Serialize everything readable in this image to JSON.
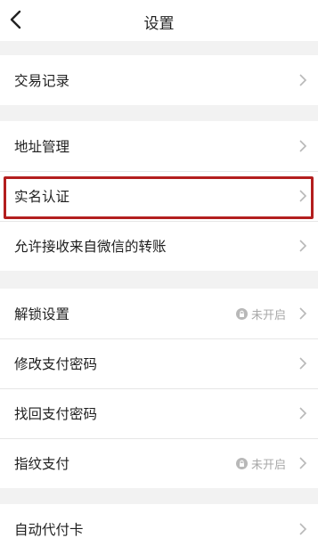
{
  "header": {
    "title": "设置"
  },
  "groups": [
    {
      "items": [
        {
          "label": "交易记录"
        }
      ]
    },
    {
      "items": [
        {
          "label": "地址管理"
        },
        {
          "label": "实名认证"
        },
        {
          "label": "允许接收来自微信的转账"
        }
      ]
    },
    {
      "items": [
        {
          "label": "解锁设置",
          "status": "未开启"
        },
        {
          "label": "修改支付密码"
        },
        {
          "label": "找回支付密码"
        },
        {
          "label": "指纹支付",
          "status": "未开启"
        }
      ]
    },
    {
      "items": [
        {
          "label": "自动代付卡"
        }
      ]
    }
  ],
  "icons": {
    "back": "back-arrow-icon",
    "row": "chevron-right-icon",
    "status": "lock-icon"
  },
  "colors": {
    "background": "#f2f2f2",
    "highlight": "#b31e1e",
    "chevron": "#b8b8b8",
    "status_text": "#a8a8a8"
  }
}
